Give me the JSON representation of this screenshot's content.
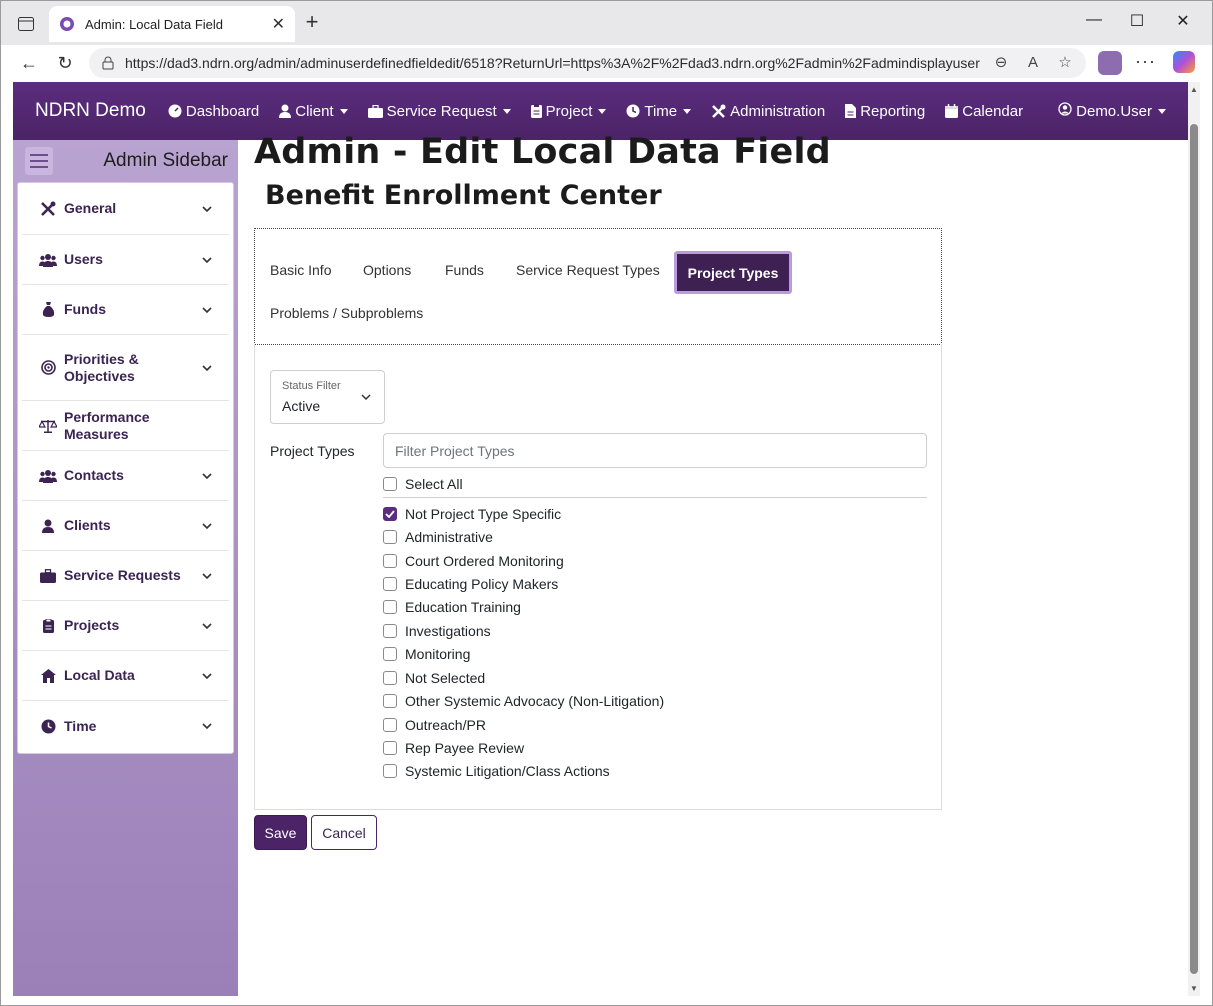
{
  "browser": {
    "tab_title": "Admin: Local Data Field",
    "url": "https://dad3.ndrn.org/admin/adminuserdefinedfieldedit/6518?ReturnUrl=https%3A%2F%2Fdad3.ndrn.org%2Fadmin%2Fadmindisplayuser..."
  },
  "navbar": {
    "brand": "NDRN Demo",
    "items": [
      {
        "label": "Dashboard",
        "icon": "dashboard-icon",
        "dropdown": false
      },
      {
        "label": "Client",
        "icon": "person-icon",
        "dropdown": true
      },
      {
        "label": "Service Request",
        "icon": "briefcase-icon",
        "dropdown": true
      },
      {
        "label": "Project",
        "icon": "clipboard-icon",
        "dropdown": true
      },
      {
        "label": "Time",
        "icon": "clock-icon",
        "dropdown": true
      },
      {
        "label": "Administration",
        "icon": "tools-icon",
        "dropdown": false
      },
      {
        "label": "Reporting",
        "icon": "document-icon",
        "dropdown": false
      },
      {
        "label": "Calendar",
        "icon": "calendar-icon",
        "dropdown": false
      }
    ],
    "user": "Demo.User"
  },
  "sidebar": {
    "title": "Admin Sidebar",
    "items": [
      {
        "label": "General",
        "icon": "tools-icon",
        "expandable": true
      },
      {
        "label": "Users",
        "icon": "users-icon",
        "expandable": true
      },
      {
        "label": "Funds",
        "icon": "money-bag-icon",
        "expandable": true
      },
      {
        "label": "Priorities & Objectives",
        "icon": "target-icon",
        "expandable": true
      },
      {
        "label": "Performance Measures",
        "icon": "scale-icon",
        "expandable": false
      },
      {
        "label": "Contacts",
        "icon": "users-icon",
        "expandable": true
      },
      {
        "label": "Clients",
        "icon": "person-icon",
        "expandable": true
      },
      {
        "label": "Service Requests",
        "icon": "briefcase-icon",
        "expandable": true
      },
      {
        "label": "Projects",
        "icon": "clipboard-icon",
        "expandable": true
      },
      {
        "label": "Local Data",
        "icon": "house-icon",
        "expandable": true
      },
      {
        "label": "Time",
        "icon": "clock-icon",
        "expandable": true
      }
    ]
  },
  "main": {
    "title": "Admin - Edit Local Data Field",
    "subtitle": "Benefit Enrollment Center",
    "tabs": [
      "Basic Info",
      "Options",
      "Funds",
      "Service Request Types",
      "Project Types",
      "Problems / Subproblems"
    ],
    "active_tab": "Project Types",
    "status_filter": {
      "label": "Status Filter",
      "value": "Active"
    },
    "project_types_label": "Project Types",
    "filter_placeholder": "Filter Project Types",
    "select_all": "Select All",
    "options": [
      {
        "label": "Not Project Type Specific",
        "checked": true
      },
      {
        "label": "Administrative",
        "checked": false
      },
      {
        "label": "Court Ordered Monitoring",
        "checked": false
      },
      {
        "label": "Educating Policy Makers",
        "checked": false
      },
      {
        "label": "Education Training",
        "checked": false
      },
      {
        "label": "Investigations",
        "checked": false
      },
      {
        "label": "Monitoring",
        "checked": false
      },
      {
        "label": "Not Selected",
        "checked": false
      },
      {
        "label": "Other Systemic Advocacy (Non-Litigation)",
        "checked": false
      },
      {
        "label": "Outreach/PR",
        "checked": false
      },
      {
        "label": "Rep Payee Review",
        "checked": false
      },
      {
        "label": "Systemic Litigation/Class Actions",
        "checked": false
      }
    ],
    "save_label": "Save",
    "cancel_label": "Cancel"
  },
  "colors": {
    "brand_purple": "#4b2366",
    "sidebar_lavender": "#b9a3d0",
    "active_tab_border": "#b99ce0"
  }
}
